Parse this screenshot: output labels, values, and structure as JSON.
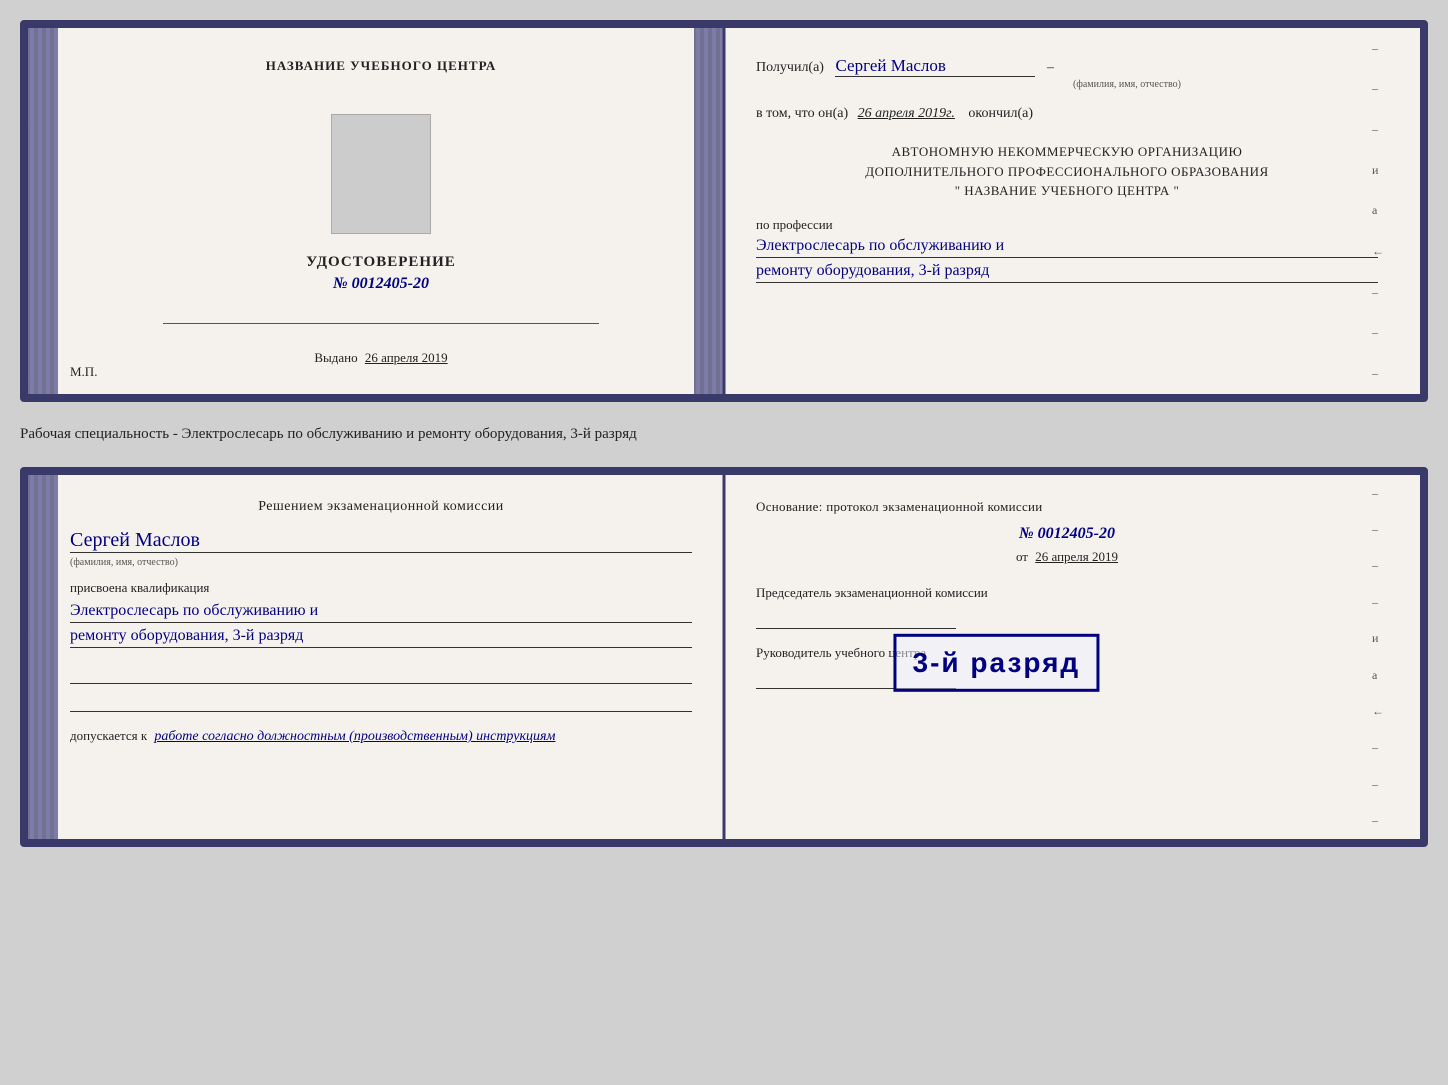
{
  "page": {
    "background": "#d0d0d0"
  },
  "top_card": {
    "left": {
      "center_title": "НАЗВАНИЕ УЧЕБНОГО ЦЕНТРА",
      "udostoverenie_label": "УДОСТОВЕРЕНИЕ",
      "udostoverenie_num": "№ 0012405-20",
      "vydano_label": "Выдано",
      "vydano_date": "26 апреля 2019",
      "mp_label": "М.П."
    },
    "right": {
      "poluchil_prefix": "Получил(а)",
      "fio_value": "Сергей Маслов",
      "fio_hint": "(фамилия, имя, отчество)",
      "dash": "–",
      "vtom_prefix": "в том, что он(а)",
      "vtom_date": "26 апреля 2019г.",
      "okochil_label": "окончил(а)",
      "autonomous_line1": "АВТОНОМНУЮ НЕКОММЕРЧЕСКУЮ ОРГАНИЗАЦИЮ",
      "autonomous_line2": "ДОПОЛНИТЕЛЬНОГО ПРОФЕССИОНАЛЬНОГО ОБРАЗОВАНИЯ",
      "autonomous_line3": "\"   НАЗВАНИЕ УЧЕБНОГО ЦЕНТРА   \"",
      "po_professii_label": "по профессии",
      "profession_line1": "Электрослесарь по обслуживанию и",
      "profession_line2": "ремонту оборудования, 3-й разряд"
    }
  },
  "between_label": {
    "text": "Рабочая специальность - Электрослесарь по обслуживанию и ремонту оборудования, 3-й разряд"
  },
  "bottom_card": {
    "left": {
      "resheniem_title": "Решением экзаменационной комиссии",
      "fio_value": "Сергей Маслов",
      "fio_hint": "(фамилия, имя, отчество)",
      "prisvoena_label": "присвоена квалификация",
      "qualification_line1": "Электрослесарь по обслуживанию и",
      "qualification_line2": "ремонту оборудования, 3-й разряд",
      "dopuskaetsya_prefix": "допускается к",
      "dopuskaetsya_value": "работе согласно должностным (производственным) инструкциям"
    },
    "right": {
      "osnovanie_label": "Основание: протокол экзаменационной комиссии",
      "protocol_num": "№ 0012405-20",
      "ot_prefix": "от",
      "ot_date": "26 апреля 2019",
      "predsedatel_label": "Председатель экзаменационной комиссии",
      "rukovoditel_label": "Руководитель учебного центра"
    },
    "stamp": {
      "text": "3-й разряд"
    }
  },
  "icons": {
    "dash": "–"
  }
}
